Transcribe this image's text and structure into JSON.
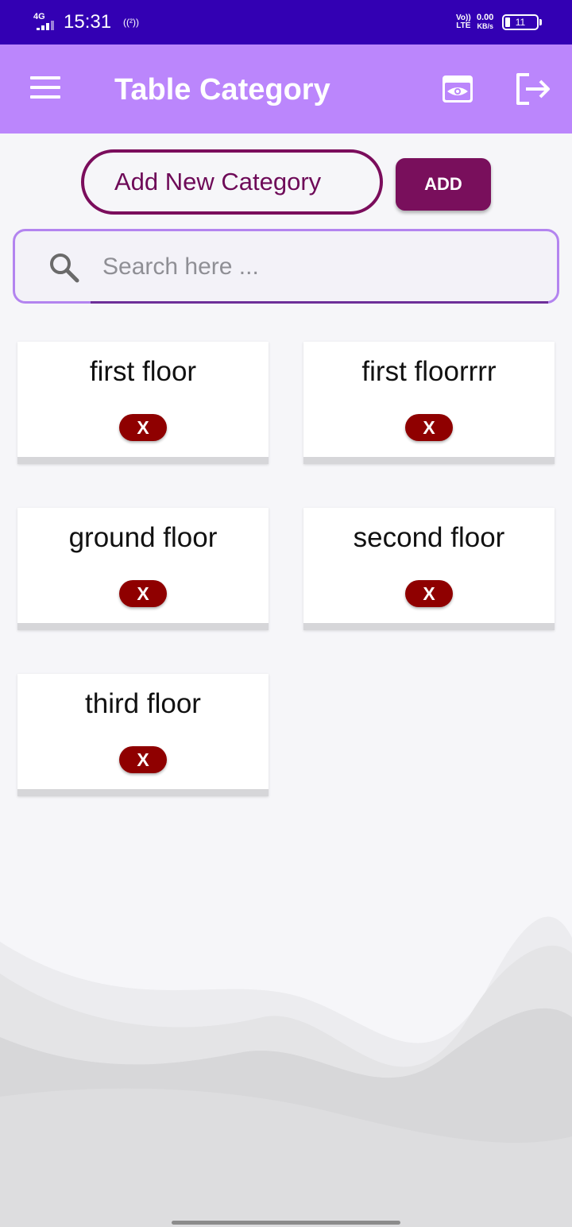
{
  "status_bar": {
    "network": "4G",
    "time": "15:31",
    "hotspot": "((²))",
    "lte_top": "Vo))",
    "lte_bottom": "LTE",
    "speed": "0.00",
    "speed_unit": "KB/s",
    "battery": "11"
  },
  "app_bar": {
    "title": "Table Category",
    "menu_icon": "menu-icon",
    "view_icon": "eye-icon",
    "logout_icon": "logout-icon"
  },
  "add_form": {
    "placeholder": "Add New Category",
    "button_label": "ADD"
  },
  "search": {
    "placeholder": "Search here ..."
  },
  "categories": [
    {
      "label": "first floor",
      "delete_label": "X"
    },
    {
      "label": "first floorrrr",
      "delete_label": "X"
    },
    {
      "label": "ground floor",
      "delete_label": "X"
    },
    {
      "label": "second floor",
      "delete_label": "X"
    },
    {
      "label": "third floor",
      "delete_label": "X"
    }
  ],
  "colors": {
    "status_bar": "#3300b3",
    "app_bar": "#bb86fc",
    "accent": "#790f5c",
    "delete": "#8f0000"
  }
}
